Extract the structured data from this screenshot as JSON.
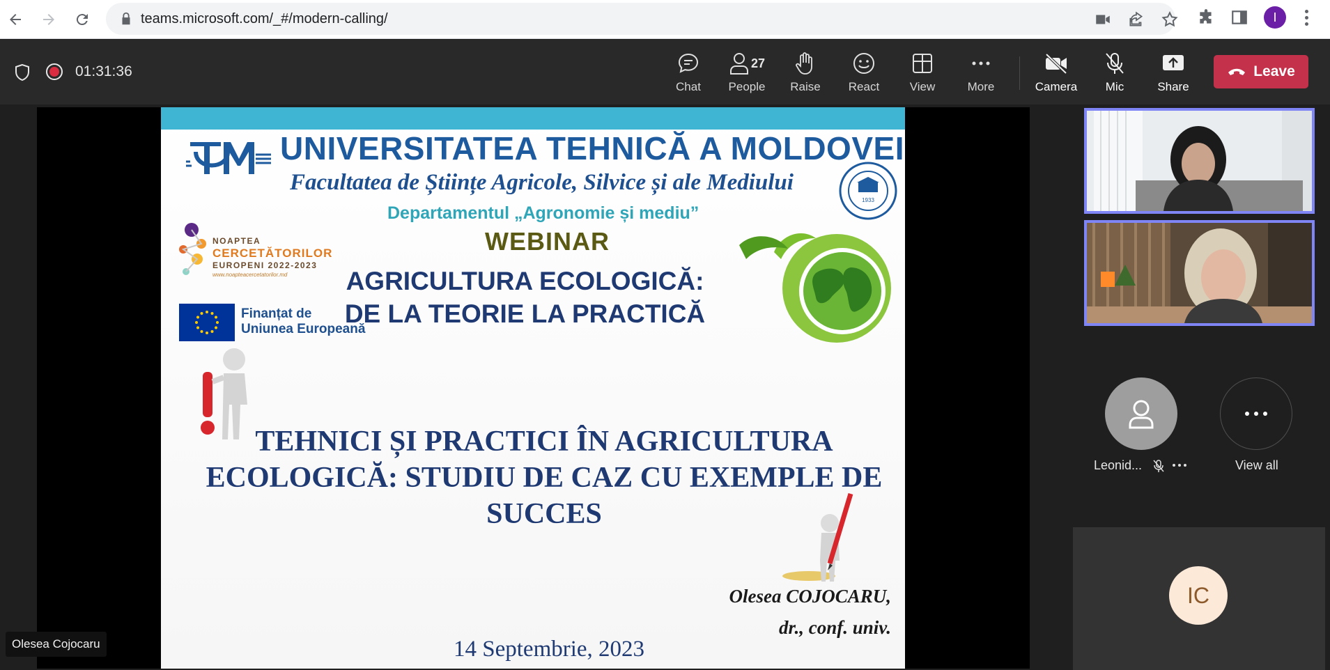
{
  "browser": {
    "url": "teams.microsoft.com/_#/modern-calling/",
    "profile_initial": "I"
  },
  "meeting": {
    "timer": "01:31:36",
    "toolbar": {
      "chat": "Chat",
      "people": "People",
      "people_count": "27",
      "raise": "Raise",
      "react": "React",
      "view": "View",
      "more": "More",
      "camera": "Camera",
      "mic": "Mic",
      "share": "Share",
      "leave": "Leave"
    },
    "leave_color": "#c4314b"
  },
  "slide": {
    "university": "UNIVERSITATEA TEHNICĂ A MOLDOVEI",
    "faculty": "Facultatea de Științe Agricole, Silvice și ale Mediului",
    "department": "Departamentul „Agronomie și mediu”",
    "event": "WEBINAR",
    "subtitle_line1": "AGRICULTURA ECOLOGICĂ:",
    "subtitle_line2": "DE LA TEORIE LA PRACTICĂ",
    "noaptea_1": "NOAPTEA",
    "noaptea_2": "CERCETĂTORILOR",
    "noaptea_3": "EUROPENI 2022-2023",
    "noaptea_4": "www.noapteacercetatorilor.md",
    "eu_line1": "Finanțat de",
    "eu_line2": "Uniunea Europeană",
    "title_line1": "TEHNICI ȘI PRACTICI ÎN AGRICULTURA",
    "title_line2": "ECOLOGICĂ: STUDIU DE CAZ CU EXEMPLE DE",
    "title_line3": "SUCCES",
    "author_name": "Olesea COJOCARU,",
    "author_title": "dr., conf. univ.",
    "date": "14 Septembrie, 2023",
    "seal_year": "1933"
  },
  "presenter": {
    "name": "Olesea Cojocaru"
  },
  "participants": {
    "audio_only_name": "Leonid...",
    "view_all": "View all",
    "self_initials": "IC"
  },
  "colors": {
    "accent": "#7f85f5",
    "slide_band": "#3fb5d3",
    "title_blue": "#1f3a72"
  }
}
